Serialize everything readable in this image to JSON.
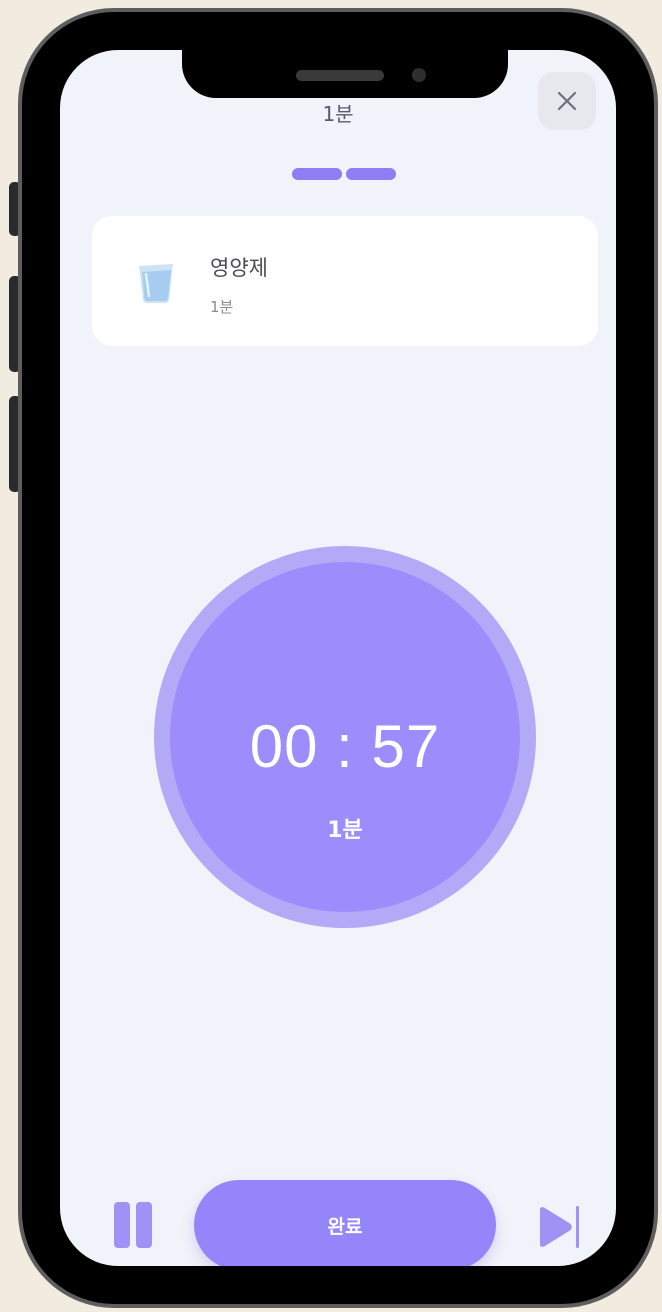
{
  "header": {
    "title": "1분",
    "close_icon": "close-icon"
  },
  "progress": {
    "segments": 2,
    "color": "#8d7ff3"
  },
  "task": {
    "icon": "water-cup-icon",
    "name": "영양제",
    "duration": "1분"
  },
  "timer": {
    "time": "00 : 57",
    "label": "1분",
    "color": "#9c8cfc"
  },
  "controls": {
    "pause_icon": "pause-icon",
    "done_label": "완료",
    "skip_icon": "skip-next-icon"
  },
  "colors": {
    "accent": "#9585fb",
    "background": "#f0f3f9"
  }
}
